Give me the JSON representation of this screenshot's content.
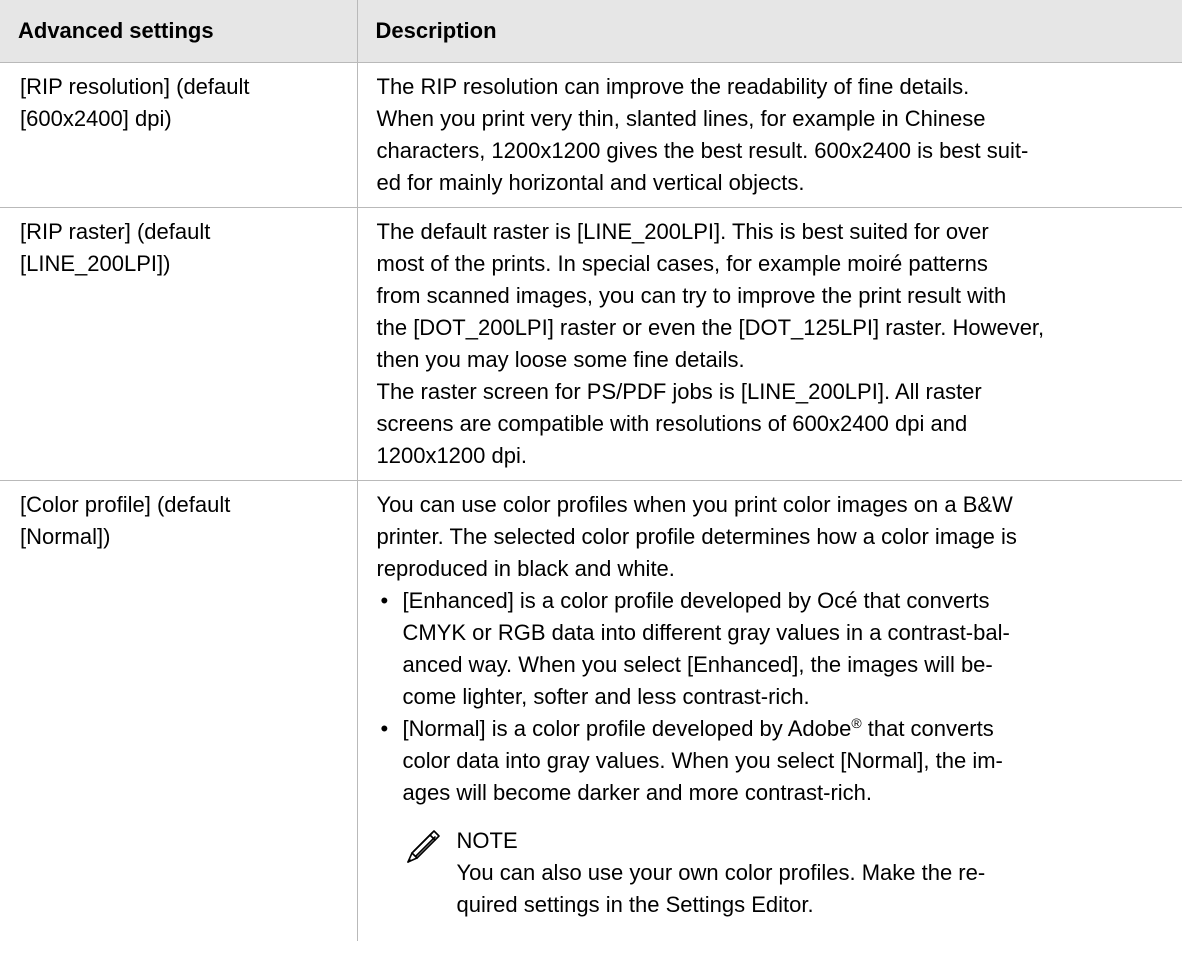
{
  "table": {
    "headers": [
      "Advanced settings",
      "Description"
    ],
    "rows": [
      {
        "setting_lines": [
          "[RIP resolution] (default",
          "[600x2400] dpi)"
        ],
        "desc_lines": [
          "The RIP resolution can improve the readability of fine details.",
          "When you print very thin, slanted lines, for example in Chinese",
          "characters, 1200x1200 gives the best result. 600x2400 is best suit-",
          "ed for mainly horizontal and vertical objects."
        ]
      },
      {
        "setting_lines": [
          "[RIP raster] (default",
          "[LINE_200LPI])"
        ],
        "desc_lines": [
          "The default raster is [LINE_200LPI]. This is best suited for over",
          "most of the prints. In special cases, for example moiré patterns",
          "from scanned images, you can try to improve the print result with",
          "the [DOT_200LPI] raster or even the [DOT_125LPI] raster. However,",
          "then you may loose some fine details.",
          "The raster screen for PS/PDF jobs is [LINE_200LPI]. All raster",
          "screens are compatible with resolutions of 600x2400 dpi and",
          "1200x1200 dpi."
        ]
      },
      {
        "setting_lines": [
          "[Color profile] (default",
          "[Normal])"
        ],
        "desc_lines": [
          "You can use color profiles when you print color images on a B&W",
          "printer. The selected color profile determines how a color image is",
          "reproduced in black and white."
        ],
        "bullet_char": "•",
        "bullets": [
          {
            "lines": [
              "[Enhanced] is a color profile developed by Océ that converts",
              "CMYK or RGB data into different gray values in a contrast-bal-",
              "anced way. When you select [Enhanced], the images will be-",
              "come lighter, softer and less contrast-rich."
            ]
          },
          {
            "first_line_before": "[Normal] is a color profile developed by Adobe",
            "first_line_sup": "®",
            "first_line_after": " that converts",
            "lines": [
              "color data into gray values. When you select [Normal], the im-",
              "ages will become darker and more contrast-rich."
            ]
          }
        ],
        "note": {
          "icon": "pencil-icon",
          "title": "NOTE",
          "lines": [
            "You can also use your own color profiles. Make the re-",
            "quired settings in the Settings Editor."
          ]
        }
      }
    ]
  },
  "colors": {
    "header_bg": "#e6e6e6",
    "border": "#b9b9b9",
    "text": "#000000"
  }
}
